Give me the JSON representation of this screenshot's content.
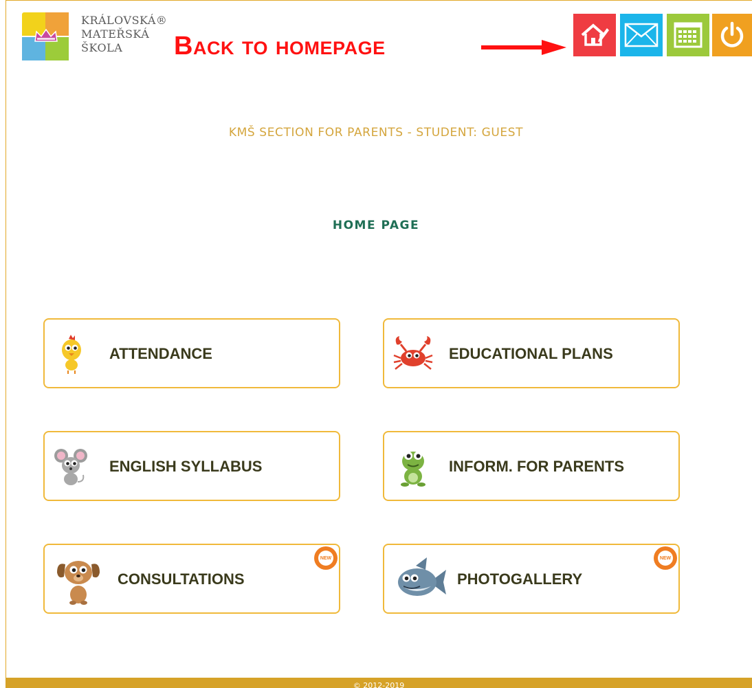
{
  "logo": {
    "line1": "KRÁLOVSKÁ®",
    "line2": "MATEŘSKÁ",
    "line3": "ŠKOLA",
    "colors": [
      "#f2d21b",
      "#f0a23a",
      "#5fb4e0",
      "#9ccc3a"
    ]
  },
  "annotation": {
    "text": "Back to homepage",
    "color": "#ff1111"
  },
  "toolbar": [
    {
      "name": "home-edit-icon",
      "color": "#ef3c42"
    },
    {
      "name": "mail-icon",
      "color": "#1bb5ea"
    },
    {
      "name": "calendar-icon",
      "color": "#9cc93b"
    },
    {
      "name": "power-icon",
      "color": "#f0a020"
    }
  ],
  "subtitle": "KMŠ SECTION FOR PARENTS - STUDENT: GUEST",
  "page_title": "HOME PAGE",
  "menu": [
    {
      "label": "ATTENDANCE",
      "icon": "chick-icon",
      "new": false
    },
    {
      "label": "EDUCATIONAL PLANS",
      "icon": "crab-icon",
      "new": false
    },
    {
      "label": "ENGLISH SYLLABUS",
      "icon": "mouse-icon",
      "new": false
    },
    {
      "label": "INFORM. FOR PARENTS",
      "icon": "frog-icon",
      "new": false
    },
    {
      "label": "CONSULTATIONS",
      "icon": "dog-icon",
      "new": true,
      "badge": "NEW"
    },
    {
      "label": "PHOTOGALLERY",
      "icon": "shark-icon",
      "new": true,
      "badge": "NEW"
    }
  ],
  "footer": "© 2012-2019",
  "colors": {
    "accent": "#e2a827",
    "title": "#1f6f55",
    "subtitle": "#d4a53c"
  }
}
